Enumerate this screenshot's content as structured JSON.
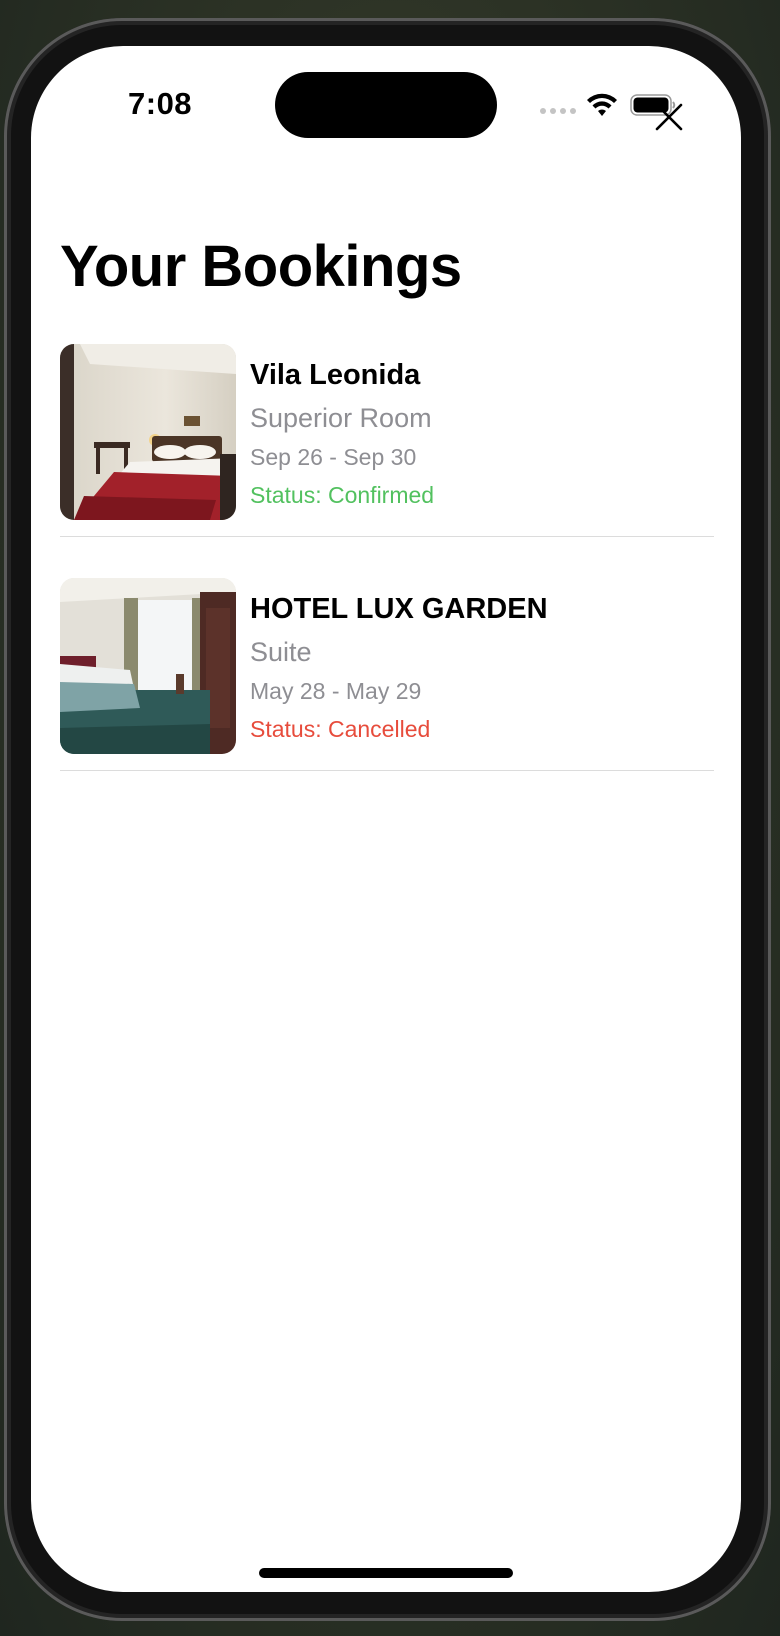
{
  "status_bar": {
    "time": "7:08",
    "icons": [
      "signal-icon",
      "wifi-icon",
      "battery-icon"
    ]
  },
  "header": {
    "title": "Your Bookings",
    "close_icon": "close-icon"
  },
  "bookings": [
    {
      "hotel": "Vila Leonida",
      "room": "Superior Room",
      "dates": "Sep 26 - Sep 30",
      "status": "Status: Confirmed",
      "status_color": "#52c15f",
      "image": "hotel-room-photo"
    },
    {
      "hotel": "HOTEL LUX GARDEN",
      "room": "Suite",
      "dates": "May 28 - May 29",
      "status": "Status: Cancelled",
      "status_color": "#e74c3c",
      "image": "hotel-room-photo"
    }
  ],
  "colors": {
    "confirmed": "#52c15f",
    "cancelled": "#e74c3c",
    "secondary_text": "#8e8e93",
    "separator": "#dcdcdc"
  }
}
